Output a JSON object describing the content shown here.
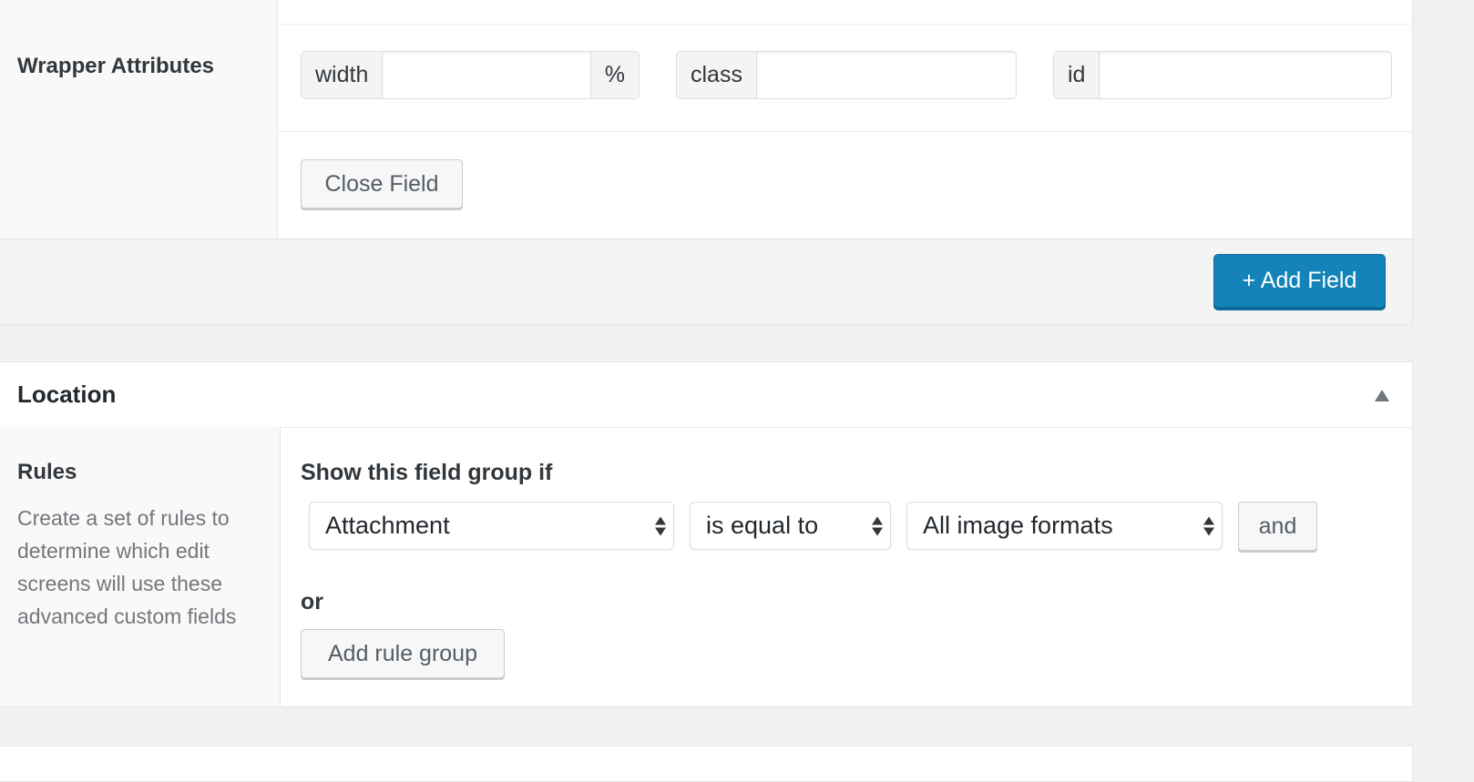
{
  "field_settings": {
    "wrapper_label": "Wrapper Attributes",
    "width": {
      "prefix": "width",
      "value": "",
      "suffix": "%"
    },
    "class": {
      "prefix": "class",
      "value": ""
    },
    "id": {
      "prefix": "id",
      "value": ""
    },
    "close_field_label": "Close Field",
    "add_field_label": "+ Add Field"
  },
  "location": {
    "title": "Location",
    "toggle_icon": "triangle-up-icon",
    "rules_label": "Rules",
    "rules_description": "Create a set of rules to determine which edit screens will use these advanced custom fields",
    "show_if_label": "Show this field group if",
    "rule": {
      "param": "Attachment",
      "operator": "is equal to",
      "value": "All image formats",
      "and_label": "and"
    },
    "or_label": "or",
    "add_rule_group_label": "Add rule group"
  }
}
